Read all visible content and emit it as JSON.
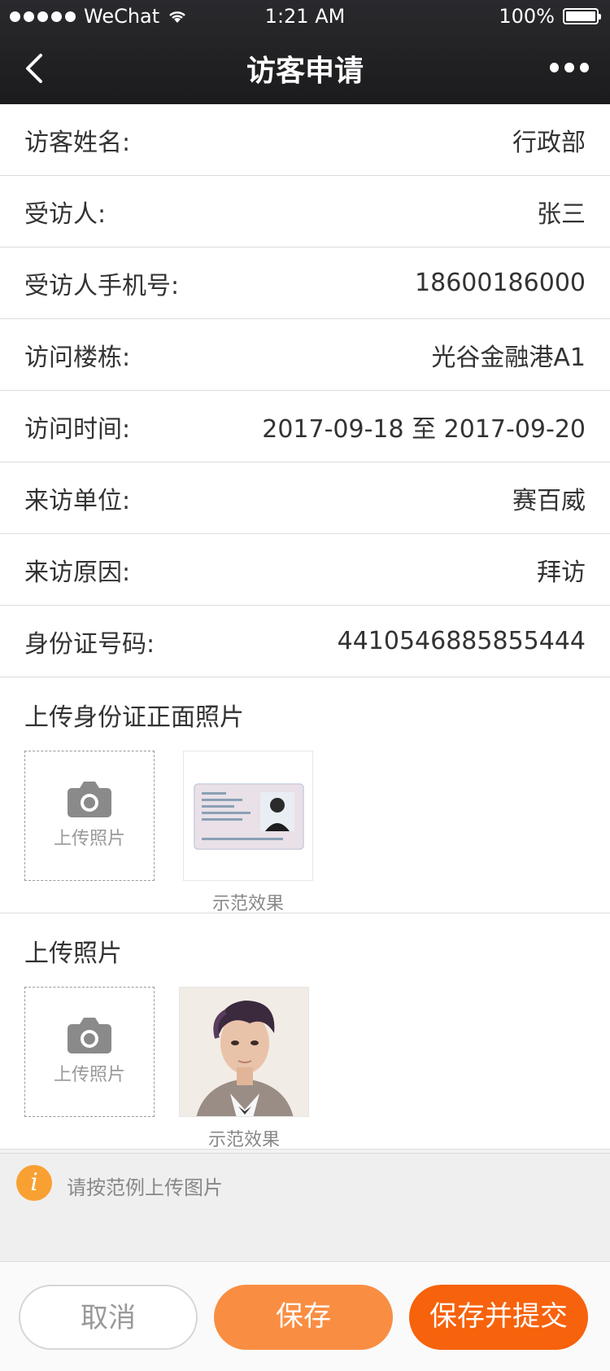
{
  "status_bar": {
    "carrier": "WeChat",
    "time": "1:21 AM",
    "battery": "100%"
  },
  "nav": {
    "title": "访客申请",
    "back_icon": "chevron-left-icon",
    "more_icon": "more-dots-icon"
  },
  "form": {
    "rows": [
      {
        "label": "访客姓名:",
        "value": "行政部"
      },
      {
        "label": "受访人:",
        "value": "张三"
      },
      {
        "label": "受访人手机号:",
        "value": "18600186000"
      },
      {
        "label": "访问楼栋:",
        "value": "光谷金融港A1"
      },
      {
        "label": "访问时间:",
        "value": "2017-09-18 至 2017-09-20"
      },
      {
        "label": "来访单位:",
        "value": "赛百威"
      },
      {
        "label": "来访原因:",
        "value": "拜访"
      },
      {
        "label": "身份证号码:",
        "value": "4410546885855444"
      }
    ]
  },
  "id_upload": {
    "title": "上传身份证正面照片",
    "upload_label": "上传照片",
    "sample_caption": "示范效果"
  },
  "photo_upload": {
    "title": "上传照片",
    "upload_label": "上传照片",
    "sample_caption": "示范效果"
  },
  "note": {
    "text": "请按范例上传图片",
    "icon": "info-icon",
    "icon_color": "#f8a132"
  },
  "footer": {
    "cancel_label": "取消",
    "save_label": "保存",
    "submit_label": "保存并提交",
    "accent_color": "#f7620c"
  }
}
